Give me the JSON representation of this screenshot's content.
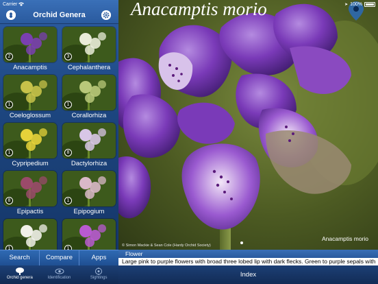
{
  "status_bar": {
    "carrier": "Carrier",
    "time": "",
    "battery": "100%"
  },
  "sidebar": {
    "title": "Orchid Genera",
    "left_icon": "info-icon",
    "right_icon": "gear-icon",
    "genera": [
      {
        "name": "Anacamptis",
        "count": "2",
        "color": "#7a3fb0"
      },
      {
        "name": "Cephalanthera",
        "count": "3",
        "color": "#e9ecd8"
      },
      {
        "name": "Coeloglossum",
        "count": "1",
        "color": "#c7c24a"
      },
      {
        "name": "Corallorhiza",
        "count": "1",
        "color": "#b9c87a"
      },
      {
        "name": "Cypripedium",
        "count": "1",
        "color": "#e6d23a"
      },
      {
        "name": "Dactylorhiza",
        "count": "8",
        "color": "#d8c6e6"
      },
      {
        "name": "Epipactis",
        "count": "8",
        "color": "#9a4a6a"
      },
      {
        "name": "Epipogium",
        "count": "1",
        "color": "#d9b8c8"
      },
      {
        "name": "",
        "count": "1",
        "color": "#f0f0e8"
      },
      {
        "name": "",
        "count": "1",
        "color": "#b85ad0"
      }
    ],
    "actions": [
      "Search",
      "Compare",
      "Apps"
    ]
  },
  "main": {
    "photo_title": "Anacamptis morio",
    "credit": "© Simon Mackie & Sean Cole (Hardy Orchid Society)",
    "caption": "Anacamptis morio",
    "section_header": "Flower",
    "description": "Large pink to purple flowers with broad three lobed lip with dark flecks. Green to purple sepals with",
    "index_label": "Index"
  },
  "tabbar": {
    "tabs": [
      {
        "label": "Orchid genera",
        "icon": "tree-icon",
        "active": true
      },
      {
        "label": "Identification",
        "icon": "eye-icon",
        "active": false
      },
      {
        "label": "Sightings",
        "icon": "target-icon",
        "active": false
      }
    ]
  }
}
